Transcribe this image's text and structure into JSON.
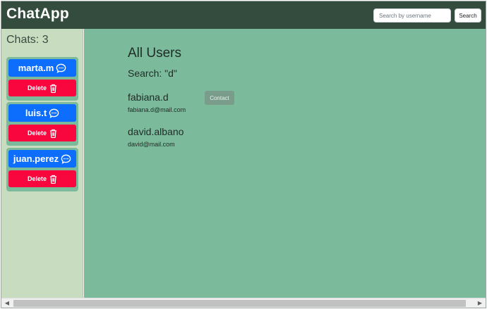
{
  "navbar": {
    "brand": "ChatApp",
    "search_placeholder": "Search by username",
    "search_button": "Search"
  },
  "sidebar": {
    "title": "Chats: 3",
    "chats": [
      {
        "name": "marta.m",
        "delete_label": "Delete",
        "chat_icon": "chat-bubble-icon",
        "delete_icon": "trash-icon"
      },
      {
        "name": "luis.t",
        "delete_label": "Delete",
        "chat_icon": "chat-bubble-icon",
        "delete_icon": "trash-icon"
      },
      {
        "name": "juan.perez",
        "delete_label": "Delete",
        "chat_icon": "chat-bubble-icon",
        "delete_icon": "trash-icon"
      }
    ]
  },
  "main": {
    "title": "All Users",
    "search_label": "Search: \"d\"",
    "users": [
      {
        "username": "fabiana.d",
        "email": "fabiana.d@mail.com",
        "action": "Contact"
      },
      {
        "username": "david.albano",
        "email": "david@mail.com"
      }
    ]
  },
  "colors": {
    "navbar": "#344c3d",
    "sidebar": "#c8dcc0",
    "main": "#7bbb9c",
    "primary": "#0d6efd",
    "danger": "#f8063d"
  }
}
